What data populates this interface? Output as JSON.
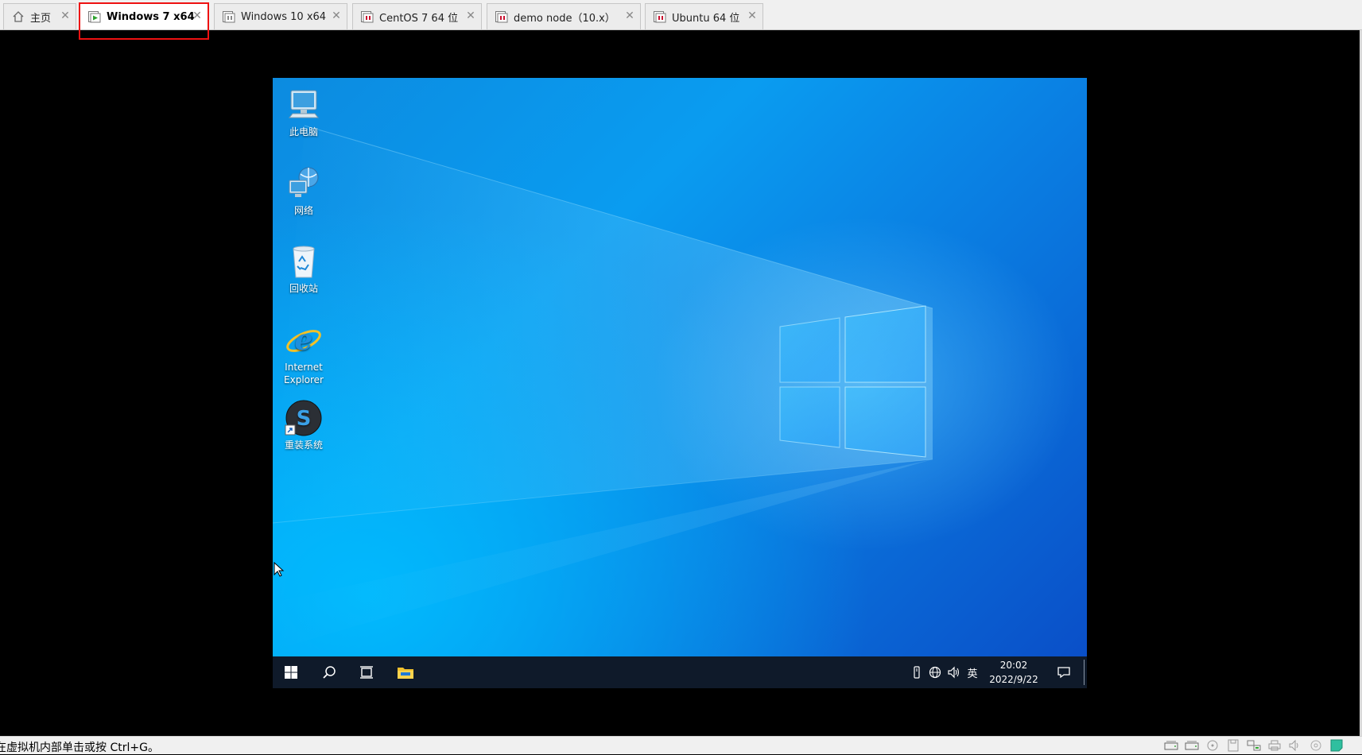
{
  "tabs": [
    {
      "label": "主页",
      "icon": "home-icon",
      "active": false
    },
    {
      "label": "Windows 7 x64",
      "icon": "vm-running-icon",
      "active": true
    },
    {
      "label": "Windows 10 x64",
      "icon": "vm-icon",
      "active": false
    },
    {
      "label": "CentOS 7 64 位",
      "icon": "vm-icon",
      "active": false
    },
    {
      "label": "demo node（10.x）",
      "icon": "vm-icon",
      "active": false
    },
    {
      "label": "Ubuntu 64 位",
      "icon": "vm-icon",
      "active": false
    }
  ],
  "tab_close_glyph": "✕",
  "desktop": {
    "icons": [
      {
        "label": "此电脑",
        "icon": "this-pc-icon"
      },
      {
        "label": "网络",
        "icon": "network-icon"
      },
      {
        "label": "回收站",
        "icon": "recycle-bin-icon"
      },
      {
        "label": "Internet Explorer",
        "icon": "internet-explorer-icon"
      },
      {
        "label": "重装系统",
        "icon": "reinstall-system-icon"
      }
    ]
  },
  "taskbar": {
    "buttons": [
      "start-icon",
      "search-icon",
      "task-view-icon",
      "file-explorer-icon"
    ],
    "tray": {
      "input_method": "英",
      "time": "20:02",
      "date": "2022/9/22"
    }
  },
  "statusbar": {
    "message": "在虚拟机内部单击或按 Ctrl+G。",
    "icons": [
      "hard-disk-icon",
      "hard-disk-icon-2",
      "cd-dvd-icon",
      "floppy-icon",
      "network-adapter-icon",
      "printer-icon",
      "sound-icon",
      "usb-icon",
      "message-icon"
    ]
  },
  "colors": {
    "accent_highlight": "#ee1111",
    "desktop_blue": "#0a8ae6",
    "taskbar": "#0f1a2a"
  }
}
